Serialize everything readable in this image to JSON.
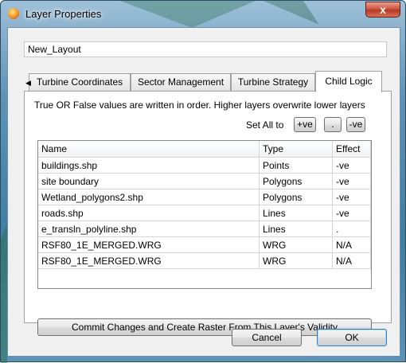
{
  "window": {
    "title": "Layer Properties",
    "close_label": "x"
  },
  "layer_name": "New_Layout",
  "tabs": [
    {
      "label": "Turbine Coordinates"
    },
    {
      "label": "Sector Management"
    },
    {
      "label": "Turbine Strategy"
    },
    {
      "label": "Child Logic"
    }
  ],
  "active_tab": "Child Logic",
  "child_logic": {
    "description": "True OR False values are written in order. Higher layers overwrite lower layers",
    "set_all_label": "Set All to",
    "set_buttons": [
      "+ve",
      ".",
      "-ve"
    ],
    "columns": [
      "Name",
      "Type",
      "Effect"
    ],
    "rows": [
      {
        "name": "buildings.shp",
        "type": "Points",
        "effect": "-ve"
      },
      {
        "name": "site boundary",
        "type": "Polygons",
        "effect": "-ve"
      },
      {
        "name": "Wetland_polygons2.shp",
        "type": "Polygons",
        "effect": "-ve"
      },
      {
        "name": "roads.shp",
        "type": "Lines",
        "effect": "-ve"
      },
      {
        "name": "e_transln_polyline.shp",
        "type": "Lines",
        "effect": "."
      },
      {
        "name": "RSF80_1E_MERGED.WRG",
        "type": "WRG",
        "effect": "N/A"
      },
      {
        "name": "RSF80_1E_MERGED.WRG",
        "type": "WRG",
        "effect": "N/A"
      }
    ],
    "commit_label": "Commit Changes and Create Raster From This Layer's Validity"
  },
  "footer": {
    "cancel_label": "Cancel",
    "ok_label": "OK"
  }
}
